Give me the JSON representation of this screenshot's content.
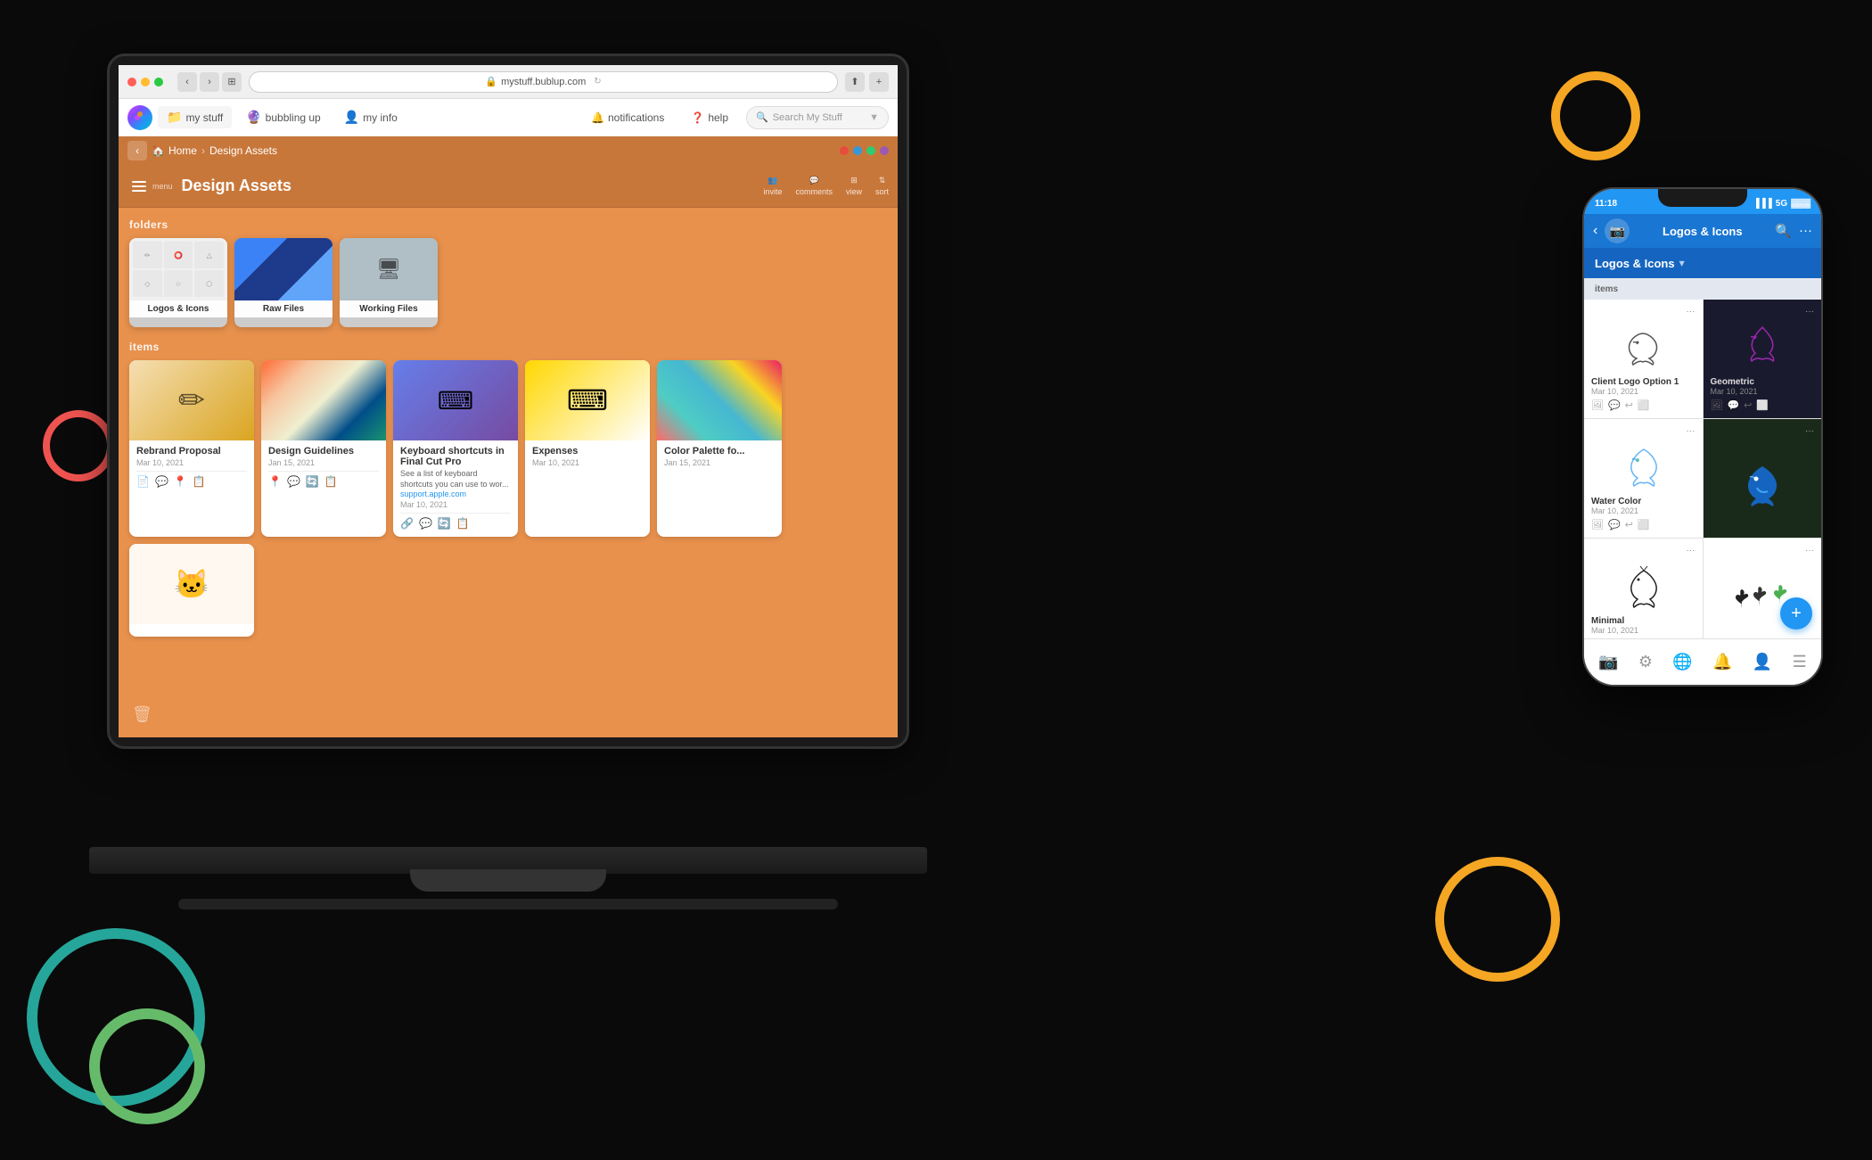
{
  "browser": {
    "url": "mystuff.bublup.com",
    "reload_icon": "↺",
    "lock_icon": "🔒",
    "share_icon": "⬆",
    "tab_icon": "⊞",
    "new_tab_icon": "+"
  },
  "app_nav": {
    "my_stuff_label": "my stuff",
    "bubbling_up_label": "bubbling up",
    "my_info_label": "my info",
    "notifications_label": "notifications",
    "help_label": "help",
    "search_placeholder": "Search My Stuff",
    "info_label": "info"
  },
  "breadcrumb": {
    "home_label": "Home",
    "current_label": "Design Assets",
    "colors": [
      "#e74c3c",
      "#3498db",
      "#2ecc71",
      "#9b59b6"
    ]
  },
  "page": {
    "title": "Design Assets",
    "menu_label": "menu",
    "invite_label": "invite",
    "comments_label": "comments",
    "view_label": "view",
    "sort_label": "sort"
  },
  "folders_section": {
    "label": "folders",
    "items": [
      {
        "name": "Logos & Icons",
        "type": "logos"
      },
      {
        "name": "Raw Files",
        "type": "raw"
      },
      {
        "name": "Working Files",
        "type": "working"
      }
    ]
  },
  "items_section": {
    "label": "items",
    "cards": [
      {
        "title": "Rebrand Proposal",
        "date": "Mar 10, 2021",
        "type": "pencil",
        "actions": [
          "📄",
          "💬",
          "🔴",
          "📋"
        ]
      },
      {
        "title": "Design Guidelines",
        "date": "Jan 15, 2021",
        "type": "design",
        "actions": [
          "🔵",
          "💬",
          "🔄",
          "📋"
        ]
      },
      {
        "title": "Keyboard shortcuts in Final Cut Pro",
        "date": "Mar 10, 2021",
        "type": "keyboard",
        "description": "See a list of keyboard shortcuts you can use to wor...",
        "link": "support.apple.com",
        "actions": [
          "🔗",
          "💬",
          "🔄",
          "📋"
        ]
      },
      {
        "title": "Expenses",
        "date": "Mar 10, 2021",
        "type": "expenses",
        "actions": []
      },
      {
        "title": "Color Palette fo...",
        "date": "Jan 15, 2021",
        "type": "color_palette",
        "actions": []
      },
      {
        "title": "",
        "date": "",
        "type": "cat",
        "actions": []
      }
    ]
  },
  "phone": {
    "time": "11:18",
    "signal": "5G",
    "nav_title": "Logos & Icons",
    "folder_title": "Logos & Icons",
    "items_label": "items",
    "grid_items": [
      {
        "title": "Client Logo Option 1",
        "date": "Mar 10, 2021",
        "type": "bird_outline",
        "menu": "···"
      },
      {
        "title": "Geometric",
        "date": "Mar 10, 2021",
        "type": "bird_purple",
        "menu": "···",
        "dark_bg": true
      },
      {
        "title": "Water Color",
        "date": "Mar 10, 2021",
        "type": "bird_outline2",
        "menu": "···"
      },
      {
        "title": "",
        "date": "",
        "type": "bird_blue",
        "menu": "···",
        "dark_bg": true
      },
      {
        "title": "Minimal",
        "date": "Mar 10, 2021",
        "type": "bird_black",
        "menu": "···"
      },
      {
        "title": "",
        "date": "",
        "type": "birds_multi",
        "menu": "···"
      }
    ],
    "bottom_nav": [
      "📷",
      "⚙",
      "🌐",
      "🔔",
      "👤",
      "☰"
    ]
  }
}
